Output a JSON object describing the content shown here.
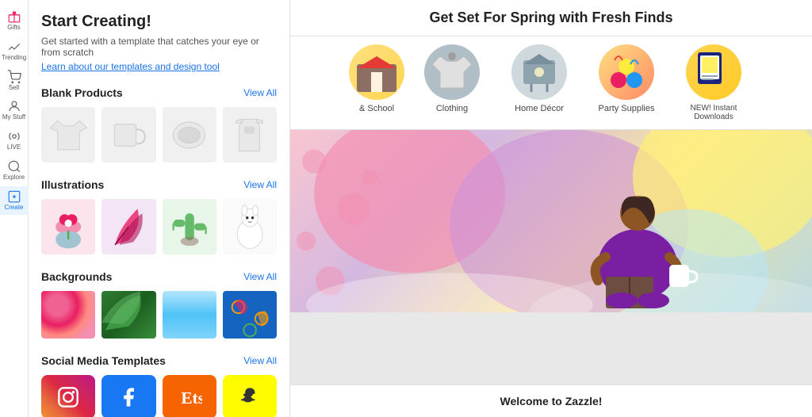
{
  "sidebar": {
    "items": [
      {
        "label": "Gifts",
        "icon": "gift"
      },
      {
        "label": "Trending",
        "icon": "trending"
      },
      {
        "label": "Sell",
        "icon": "sell"
      },
      {
        "label": "My Stuff",
        "icon": "mystuff"
      },
      {
        "label": "LIVE",
        "icon": "live"
      },
      {
        "label": "Explore",
        "icon": "explore"
      },
      {
        "label": "Create",
        "icon": "create"
      }
    ]
  },
  "panel": {
    "title": "Start Creating!",
    "subtitle": "Get started with a template that catches your eye or from scratch",
    "link_text": "Learn about our templates and design tool",
    "sections": {
      "blank_products": {
        "title": "Blank Products",
        "view_all": "View All"
      },
      "illustrations": {
        "title": "Illustrations",
        "view_all": "View All"
      },
      "backgrounds": {
        "title": "Backgrounds",
        "view_all": "View All"
      },
      "social_media": {
        "title": "Social Media Templates",
        "view_all": "View All"
      }
    }
  },
  "main": {
    "header": "Get Set For Spring with Fresh Finds",
    "categories": [
      {
        "label": "& School",
        "partial": true
      },
      {
        "label": "Clothing"
      },
      {
        "label": "Home Décor"
      },
      {
        "label": "Party Supplies"
      },
      {
        "label": "NEW! Instant Downloads"
      }
    ],
    "welcome_text": "Welcome to Zazzle!"
  }
}
